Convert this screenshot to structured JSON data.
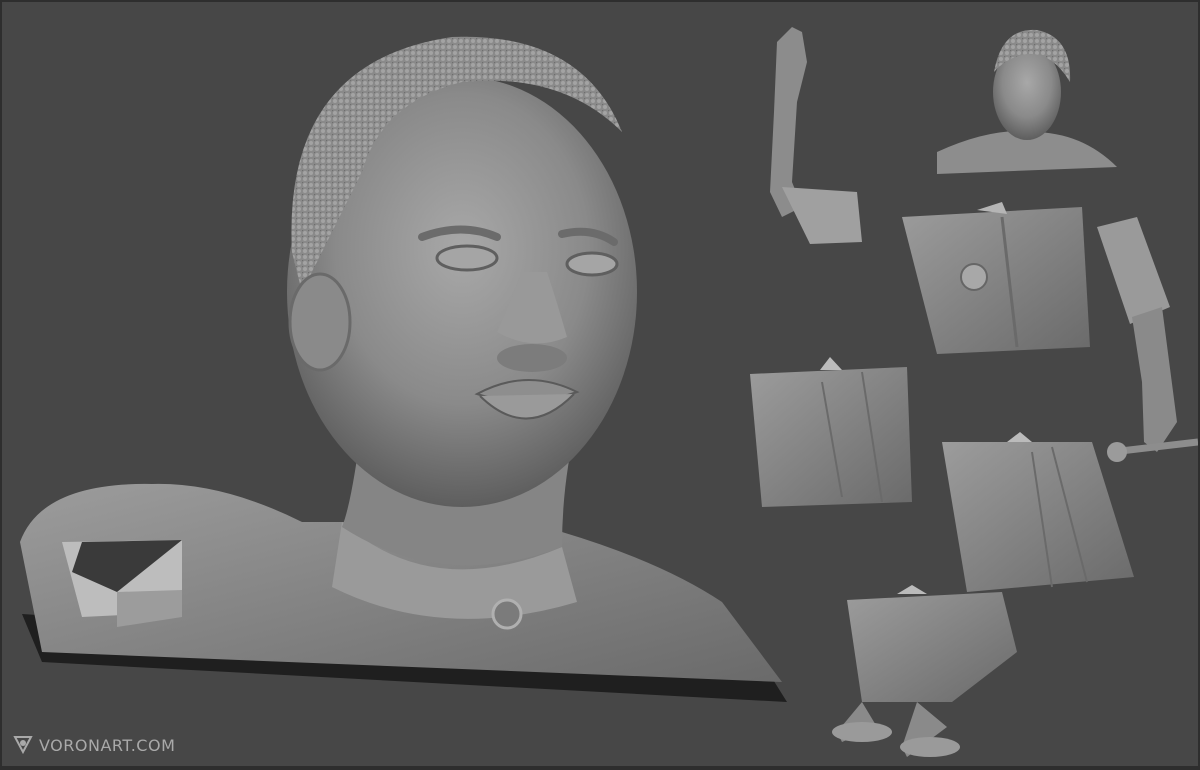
{
  "image": {
    "watermark_text": "VORONART.COM",
    "colors": {
      "background": "#474747",
      "frame": "#2e2e2e",
      "clay": "#8f8f8f",
      "clay_light": "#b5b5b5",
      "clay_dark": "#5c5c5c",
      "shadow": "#1b1b1b"
    }
  }
}
